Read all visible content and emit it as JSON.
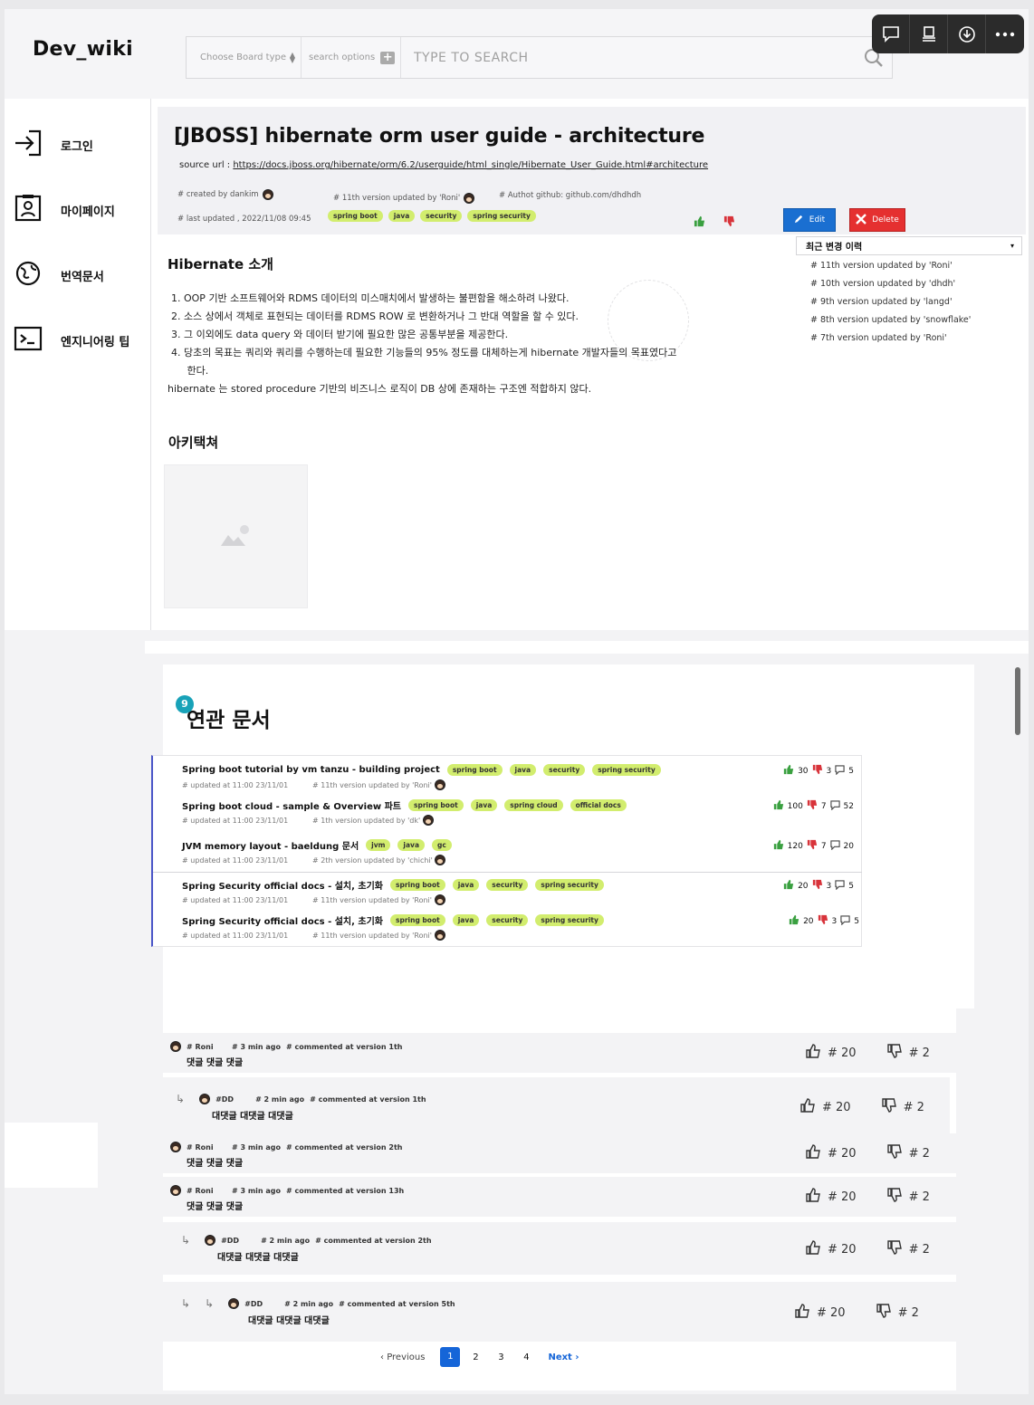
{
  "app": {
    "logo": "Dev_wiki"
  },
  "search": {
    "board_type": "Choose Board type",
    "options_label": "search options",
    "placeholder": "TYPE TO SEARCH"
  },
  "toolbar": {
    "icons": [
      "comment-icon",
      "presenter-icon",
      "download-icon",
      "more-icon"
    ]
  },
  "sidebar": {
    "items": [
      {
        "label": "로그인",
        "icon": "login-icon"
      },
      {
        "label": "마이페이지",
        "icon": "profile-icon"
      },
      {
        "label": "번역문서",
        "icon": "globe-icon"
      },
      {
        "label": "엔지니어링 팁",
        "icon": "terminal-icon"
      }
    ]
  },
  "article": {
    "title": "[JBOSS] hibernate orm user guide - architecture",
    "source_prefix": "source url : ",
    "source_url": "https://docs.jboss.org/hibernate/orm/6.2/userguide/html_single/Hibernate_User_Guide.html#architecture",
    "created_by": "# created by dankim",
    "last_updated": "# last updated , 2022/11/08 09:45",
    "version_info": "# 11th version updated by 'Roni'",
    "author_github": "# Authot github: github.com/dhdhdh",
    "tags": [
      "spring boot",
      "java",
      "security",
      "spring security"
    ],
    "edit_label": "Edit",
    "delete_label": "Delete"
  },
  "history": {
    "title": "최근 변경 이력",
    "items": [
      "# 11th version updated by 'Roni'",
      "# 10th version updated by 'dhdh'",
      "# 9th version updated by 'langd'",
      "# 8th version updated by 'snowflake'",
      "# 7th version updated by 'Roni'"
    ]
  },
  "content": {
    "intro_heading": "Hibernate 소개",
    "list": [
      "1.  OOP 기반 소프트웨어와 RDMS  데이터의 미스매치에서 발생하는 불편함을 해소하려 나왔다.",
      "2.  소스 상에서 객체로 표현되는 데이터를 RDMS ROW 로 변환하거나 그 반대 역할을 할 수 있다.",
      "3.  그 이외에도 data query 와 데이터 받기에 필요한 많은 공통부분을 제공한다.",
      "4.  당초의 목표는 쿼리와 쿼리를 수행하는데 필요한 기능들의 95% 정도를 대체하는게 hibernate 개발자들의 목표였다고",
      "     한다."
    ],
    "paragraph": "hibernate 는 stored procedure 기반의 비즈니스 로직이 DB 상에 존재하는 구조엔 적합하지 않다.",
    "arch_heading": "아키택쳐"
  },
  "related": {
    "badge": "9",
    "heading": "연관 문서",
    "items": [
      {
        "title": "Spring boot tutorial by vm tanzu - building project",
        "tags": [
          "spring boot",
          "java",
          "security",
          "spring security"
        ],
        "updated": "# updated at 11:00 23/11/01",
        "version": "# 11th version updated by 'Roni'",
        "likes": "30",
        "dislikes": "3",
        "comments": "5"
      },
      {
        "title": "Spring boot cloud - sample &  Overview 파트",
        "tags": [
          "spring boot",
          "java",
          "spring cloud",
          "official docs"
        ],
        "updated": "# updated at 11:00 23/11/01",
        "version": "# 1th version updated by 'dk'",
        "likes": "100",
        "dislikes": "7",
        "comments": "52"
      },
      {
        "title": "JVM memory layout - baeldung 문서",
        "tags": [
          "jvm",
          "java",
          "gc"
        ],
        "updated": "# updated at 11:00 23/11/01",
        "version": "# 2th version updated by 'chichi'",
        "likes": "120",
        "dislikes": "7",
        "comments": "20"
      },
      {
        "title": "Spring Security official docs - 설치, 초기화",
        "tags": [
          "spring boot",
          "java",
          "security",
          "spring security"
        ],
        "updated": "# updated at 11:00 23/11/01",
        "version": "# 11th version updated by 'Roni'",
        "likes": "20",
        "dislikes": "3",
        "comments": "5"
      },
      {
        "title": "Spring Security official docs - 설치, 초기화",
        "tags": [
          "spring boot",
          "java",
          "security",
          "spring security"
        ],
        "updated": "# updated at 11:00 23/11/01",
        "version": "# 11th version updated by 'Roni'",
        "likes": "20",
        "dislikes": "3",
        "comments": "5"
      }
    ]
  },
  "comments": [
    {
      "author": "# Roni",
      "time": "# 3 min ago",
      "version": "# commented at version 1th",
      "text": "댓글 댓글 댓글",
      "likes": "# 20",
      "dislikes": "# 2",
      "depth": 0
    },
    {
      "author": "#DD",
      "time": "# 2 min ago",
      "version": "# commented at version 1th",
      "text": "대댓글 대댓글 대댓글",
      "likes": "# 20",
      "dislikes": "# 2",
      "depth": 1
    },
    {
      "author": "# Roni",
      "time": "# 3 min ago",
      "version": "# commented at version 2th",
      "text": "댓글 댓글 댓글",
      "likes": "# 20",
      "dislikes": "# 2",
      "depth": 0
    },
    {
      "author": "# Roni",
      "time": "# 3 min ago",
      "version": "# commented at version 13h",
      "text": "댓글 댓글 댓글",
      "likes": "# 20",
      "dislikes": "# 2",
      "depth": 0
    },
    {
      "author": "#DD",
      "time": "# 2 min ago",
      "version": "# commented at version 2th",
      "text": "대댓글 대댓글 대댓글",
      "likes": "# 20",
      "dislikes": "# 2",
      "depth": 1
    },
    {
      "author": "#DD",
      "time": "# 2 min ago",
      "version": "# commented at version 5th",
      "text": "대댓글 대댓글 대댓글",
      "likes": "# 20",
      "dislikes": "# 2",
      "depth": 2
    }
  ],
  "pagination": {
    "previous": "Previous",
    "pages": [
      "1",
      "2",
      "3",
      "4"
    ],
    "current": "1",
    "next": "Next"
  },
  "colors": {
    "tag": "#d2ed6e",
    "edit": "#1a6fd1",
    "delete": "#e53030",
    "like": "#3aa040",
    "dislike": "#d8333a",
    "page_active": "#1565d8"
  }
}
